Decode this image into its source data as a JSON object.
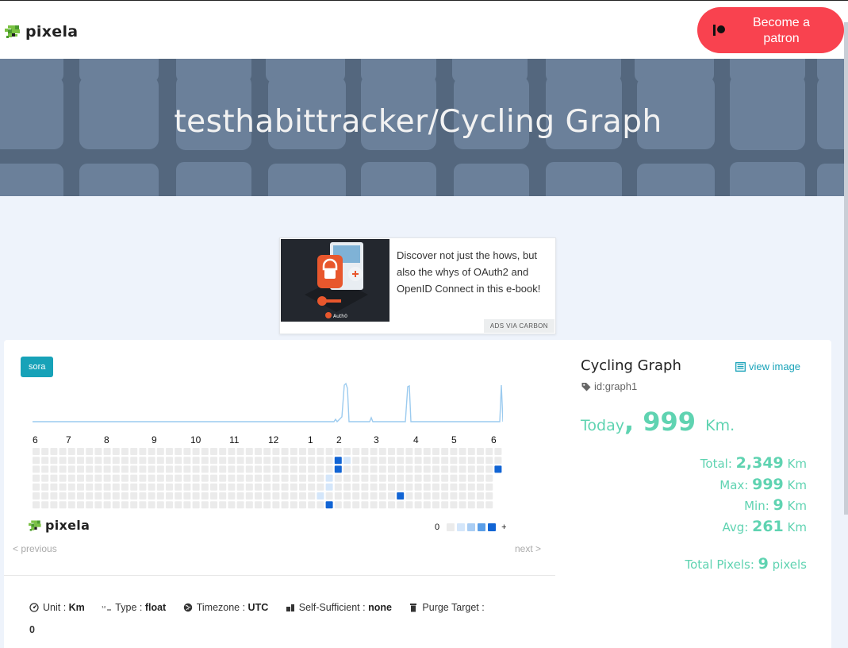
{
  "header": {
    "logo_text": "pixela",
    "patron_button": "Become a patron"
  },
  "hero": {
    "title": "testhabittracker/Cycling Graph"
  },
  "ad": {
    "text": "Discover not just the hows, but also the whys of OAuth2 and OpenID Connect in this e-book!",
    "via": "ADS VIA CARBON",
    "image_brand": "Auth0"
  },
  "graph_card": {
    "tag": "sora",
    "months": [
      "6",
      "7",
      "8",
      "9",
      "10",
      "11",
      "12",
      "1",
      "2",
      "3",
      "4",
      "5",
      "6"
    ],
    "heatmap": {
      "weeks": 53,
      "days": 7,
      "pixels": [
        {
          "week": 35,
          "day": 1,
          "level": 4
        },
        {
          "week": 35,
          "day": 2,
          "level": 4
        },
        {
          "week": 36,
          "day": 1,
          "level": 1
        },
        {
          "week": 34,
          "day": 3,
          "level": 1
        },
        {
          "week": 34,
          "day": 4,
          "level": 1
        },
        {
          "week": 33,
          "day": 5,
          "level": 1
        },
        {
          "week": 34,
          "day": 6,
          "level": 4
        },
        {
          "week": 42,
          "day": 5,
          "level": 4
        },
        {
          "week": 53,
          "day": 2,
          "level": 4
        }
      ],
      "colors": {
        "empty": "#ebebeb",
        "level1": "#d4e6fa",
        "level2": "#a9cdf4",
        "level3": "#5a9ee8",
        "level4": "#1164d4"
      }
    },
    "legend": {
      "min_label": "0",
      "max_label": "+"
    },
    "footer_logo": "pixela",
    "prev": "< previous",
    "next": "next >"
  },
  "meta": {
    "unit_label": "Unit",
    "unit_value": "Km",
    "type_label": "Type",
    "type_value": "float",
    "timezone_label": "Timezone",
    "timezone_value": "UTC",
    "self_sufficient_label": "Self-Sufficient",
    "self_sufficient_value": "none",
    "purge_label": "Purge Target",
    "purge_value": "0"
  },
  "side": {
    "title": "Cycling Graph",
    "view_image": "view image",
    "id_label": "id:graph1",
    "today_prefix": "Today",
    "today_value": "999",
    "today_unit": "Km.",
    "total_label": "Total",
    "total_value": "2,349",
    "max_label": "Max",
    "max_value": "999",
    "min_label": "Min",
    "min_value": "9",
    "avg_label": "Avg",
    "avg_value": "261",
    "unit": "Km",
    "total_pixels_label": "Total Pixels",
    "total_pixels_value": "9",
    "total_pixels_unit": "pixels"
  },
  "colors": {
    "accent_teal": "#17a2b8",
    "stat_green": "#5fd3b1",
    "patron_red": "#f9424f"
  }
}
